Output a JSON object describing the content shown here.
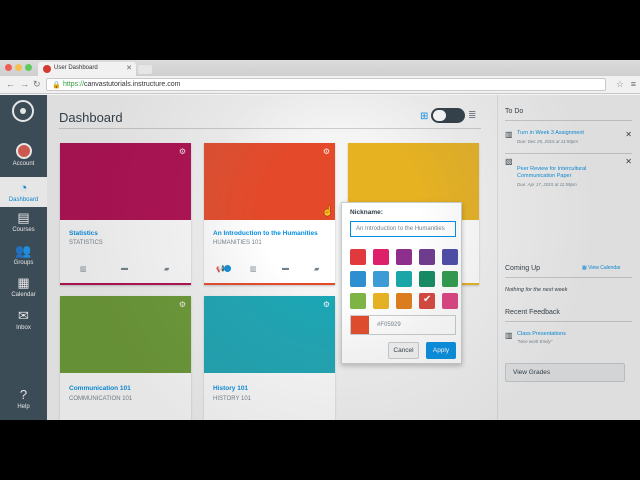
{
  "browser": {
    "tab_title": "User Dashboard",
    "url_scheme": "https://",
    "url_host": "canvastutorials.instructure.com",
    "traffic_lights": [
      "#ee5c54",
      "#f5bf4f",
      "#5ecb5d"
    ]
  },
  "nav": {
    "items": [
      {
        "label": "Account",
        "icon": "account-avatar"
      },
      {
        "label": "Dashboard",
        "icon": "dashboard-icon"
      },
      {
        "label": "Courses",
        "icon": "courses-icon"
      },
      {
        "label": "Groups",
        "icon": "groups-icon"
      },
      {
        "label": "Calendar",
        "icon": "calendar-icon"
      },
      {
        "label": "Inbox",
        "icon": "inbox-icon"
      },
      {
        "label": "Help",
        "icon": "help-icon"
      }
    ]
  },
  "dashboard": {
    "title": "Dashboard",
    "cards": [
      {
        "title": "Statistics",
        "code": "STATISTICS",
        "color": "#b0094f"
      },
      {
        "title": "An Introduction to the Humanities",
        "code": "HUMANITIES 101",
        "color": "#e44a2a",
        "badge": "1"
      },
      {
        "title": "Communication 101",
        "code": "COMMUNICATION 101",
        "color": "#6a9a32"
      },
      {
        "title": "History 101",
        "code": "HISTORY 101",
        "color": "#1aa6b5"
      }
    ]
  },
  "popover": {
    "label": "Nickname:",
    "input_value": "An Introduction to the Humanities",
    "swatches": [
      "#e0393e",
      "#de1f6a",
      "#8e2f8d",
      "#6e3b8e",
      "#4b4aa8",
      "#2d8ed0",
      "#3d9bd6",
      "#1aa6a8",
      "#128a62",
      "#2c9a4a",
      "#7db544",
      "#e7b221",
      "#e07c1a",
      "#d6453a",
      "#dd3f80"
    ],
    "selected_index": 13,
    "hex_value": "#F05929",
    "current_color": "#e44a2a",
    "cancel_label": "Cancel",
    "apply_label": "Apply"
  },
  "todo": {
    "heading": "To Do",
    "items": [
      {
        "title": "Turn in Week 3 Assignment",
        "due": "Due: Dec 25, 2015 at 11:59pm"
      },
      {
        "title": "Peer Review for Intercultural Communication Paper",
        "due": "Due: Apr 17, 2015 at 11:59pm"
      }
    ]
  },
  "coming_up": {
    "heading": "Coming Up",
    "view_calendar": "View Calendar",
    "empty": "Nothing for the next week"
  },
  "feedback": {
    "heading": "Recent Feedback",
    "item_title": "Class Presentations",
    "item_comment": "\"Nice work Emily\""
  },
  "view_grades": "View Grades"
}
